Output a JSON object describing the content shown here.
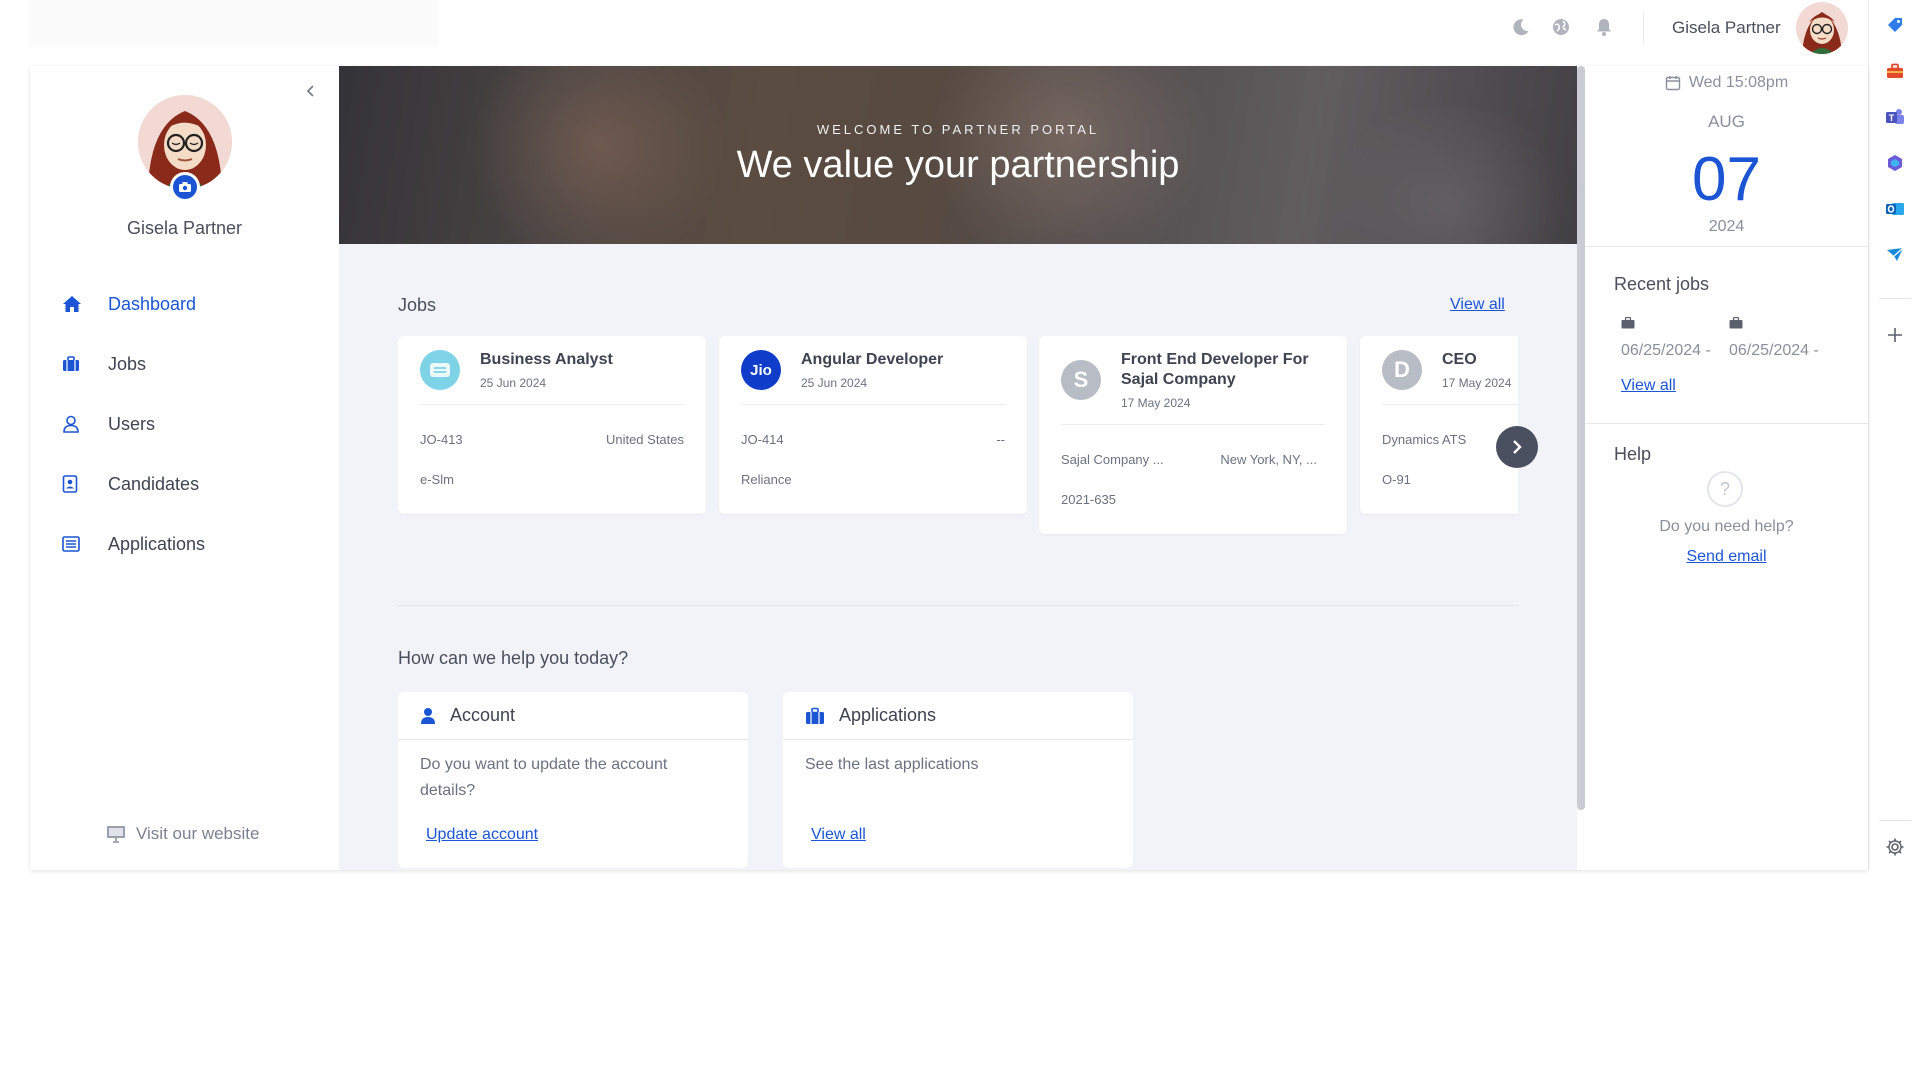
{
  "top_bar": {
    "user_name": "Gisela Partner",
    "icons": [
      "moon-icon",
      "globe-icon",
      "bell-icon"
    ]
  },
  "sidebar": {
    "profile_name": "Gisela Partner",
    "nav": [
      {
        "label": "Dashboard",
        "icon": "home-icon",
        "active": true
      },
      {
        "label": "Jobs",
        "icon": "briefcase-icon",
        "active": false
      },
      {
        "label": "Users",
        "icon": "user-icon",
        "active": false
      },
      {
        "label": "Candidates",
        "icon": "id-card-icon",
        "active": false
      },
      {
        "label": "Applications",
        "icon": "list-icon",
        "active": false
      }
    ],
    "visit_website": "Visit our website"
  },
  "hero": {
    "kicker": "WELCOME TO PARTNER PORTAL",
    "title": "We value your partnership"
  },
  "jobs": {
    "title": "Jobs",
    "view_all": "View all",
    "cards": [
      {
        "title": "Business Analyst",
        "date": "25 Jun 2024",
        "ref": "JO-413",
        "location": "United States",
        "company": "e-Slm",
        "logo": "teal-logo"
      },
      {
        "title": "Angular Developer",
        "date": "25 Jun 2024",
        "ref": "JO-414",
        "location": "--",
        "company": "Reliance",
        "logo_text": "Jio"
      },
      {
        "title": "Front End Developer For Sajal Company",
        "date": "17 May 2024",
        "ref": "Sajal Company ...",
        "location": "New York, NY, ...",
        "company": "2021-635",
        "logo_text": "S"
      },
      {
        "title": "CEO",
        "date": "17 May 2024",
        "ref": "Dynamics ATS",
        "location": "",
        "company": "O-91",
        "logo_text": "D"
      }
    ]
  },
  "help_section": {
    "title": "How can we help you today?",
    "account": {
      "title": "Account",
      "text": "Do you want to update the account details?",
      "link": "Update account"
    },
    "applications": {
      "title": "Applications",
      "text": "See the last applications",
      "link": "View all"
    }
  },
  "right_panel": {
    "datetime": "Wed 15:08pm",
    "month": "AUG",
    "day": "07",
    "year": "2024",
    "recent_jobs_title": "Recent jobs",
    "recent_jobs": [
      {
        "date": "06/25/2024 -"
      },
      {
        "date": "06/25/2024 -"
      }
    ],
    "recent_view_all": "View all",
    "help_title": "Help",
    "help_icon": "?",
    "help_text": "Do you need help?",
    "help_link": "Send email"
  },
  "colors": {
    "accent": "#1c55d4",
    "main_bg": "#f2f3f8",
    "text": "#3e4350",
    "muted": "#8a8f9c"
  }
}
